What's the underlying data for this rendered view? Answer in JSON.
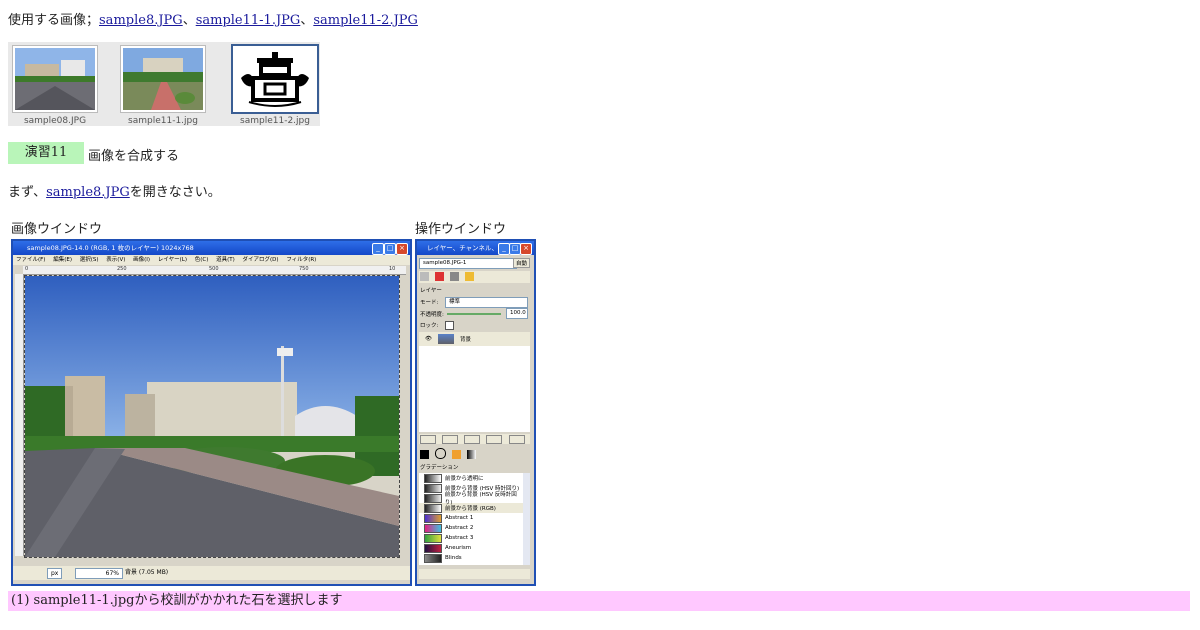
{
  "intro": {
    "prefix": "使用する画像；",
    "links": [
      "sample8.JPG",
      "sample11-1.JPG",
      "sample11-2.JPG"
    ],
    "sep": "、"
  },
  "thumbnails": [
    {
      "caption": "sample08.JPG",
      "selected": false
    },
    {
      "caption": "sample11-1.jpg",
      "selected": false
    },
    {
      "caption": "sample11-2.jpg",
      "selected": true
    }
  ],
  "exercise": {
    "badge": "演習11",
    "title": "画像を合成する"
  },
  "step1": {
    "prefix": "まず、",
    "link": "sample8.JPG",
    "suffix": "を開きなさい。"
  },
  "labels": {
    "image_window": "画像ウインドウ",
    "ops_window": "操作ウインドウ"
  },
  "image_window": {
    "title": "sample08.JPG-14.0 (RGB, 1 枚のレイヤー) 1024x768",
    "menus": [
      "ファイル(F)",
      "編集(E)",
      "選択(S)",
      "表示(V)",
      "画像(I)",
      "レイヤー(L)",
      "色(C)",
      "道具(T)",
      "ダイアログ(D)",
      "フィルタ(R)"
    ],
    "ruler_ticks": [
      "0",
      "250",
      "500",
      "750",
      "10"
    ],
    "status": {
      "unit": "px",
      "zoom": "67%",
      "info": "背景 (7.05 MB)"
    }
  },
  "ops_window": {
    "title": "レイヤー、チャンネル、パス...",
    "image_select": "sample08.JPG-1",
    "auto_button": "自動",
    "layers_label": "レイヤー",
    "mode_label": "モード:",
    "mode_value": "標準",
    "opacity_label": "不透明度:",
    "opacity_value": "100.0",
    "lock_label": "ロック:",
    "layer_name": "背景",
    "gradient_label": "グラデーション",
    "gradients": [
      {
        "name": "前景から透明に",
        "colors": [
          "#222",
          "#fff"
        ]
      },
      {
        "name": "前景から背景 (HSV 時計回り)",
        "colors": [
          "#222",
          "#eee"
        ]
      },
      {
        "name": "前景から背景 (HSV 反時計回り)",
        "colors": [
          "#222",
          "#eee"
        ]
      },
      {
        "name": "前景から背景 (RGB)",
        "colors": [
          "#222",
          "#fff"
        ]
      },
      {
        "name": "Abstract 1",
        "colors": [
          "#4a2fd0",
          "#e0a030"
        ]
      },
      {
        "name": "Abstract 2",
        "colors": [
          "#e02080",
          "#40c0e0"
        ]
      },
      {
        "name": "Abstract 3",
        "colors": [
          "#30a040",
          "#e0e040"
        ]
      },
      {
        "name": "Aneurism",
        "colors": [
          "#201040",
          "#c02040"
        ]
      },
      {
        "name": "Blinds",
        "colors": [
          "#888",
          "#222"
        ]
      }
    ]
  },
  "step_caption": "(1) sample11-1.jpgから校訓がかかれた石を選択します"
}
